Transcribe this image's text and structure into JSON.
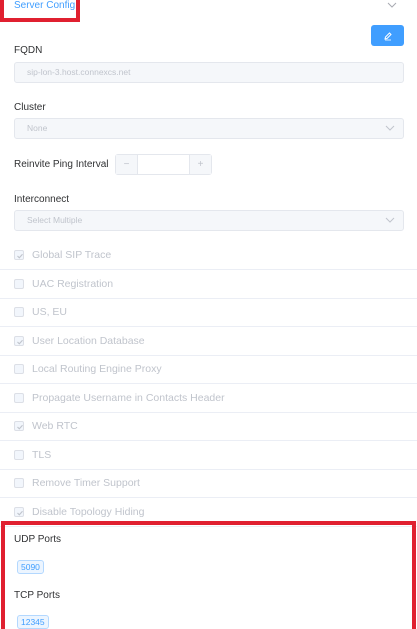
{
  "header": {
    "title": "Server Config"
  },
  "fqdn": {
    "label": "FQDN",
    "placeholder": "sip-lon-3.host.connexcs.net"
  },
  "cluster": {
    "label": "Cluster",
    "value": "None"
  },
  "reinvite": {
    "label": "Reinvite Ping Interval",
    "minus": "−",
    "plus": "+"
  },
  "interconnect": {
    "label": "Interconnect",
    "placeholder": "Select Multiple"
  },
  "options": [
    {
      "label": "Global SIP Trace",
      "checked": true
    },
    {
      "label": "UAC Registration",
      "checked": false
    },
    {
      "label": "US, EU",
      "checked": false
    },
    {
      "label": "User Location Database",
      "checked": true
    },
    {
      "label": "Local Routing Engine Proxy",
      "checked": false
    },
    {
      "label": "Propagate Username in Contacts Header",
      "checked": false
    },
    {
      "label": "Web RTC",
      "checked": true
    },
    {
      "label": "TLS",
      "checked": false
    },
    {
      "label": "Remove Timer Support",
      "checked": false
    },
    {
      "label": "Disable Topology Hiding",
      "checked": true
    }
  ],
  "ports": {
    "udp_label": "UDP Ports",
    "udp_value": "5090",
    "tcp_label": "TCP Ports",
    "tcp_value": "12345"
  },
  "colors": {
    "accent": "#409eff",
    "highlight": "#e02030"
  }
}
